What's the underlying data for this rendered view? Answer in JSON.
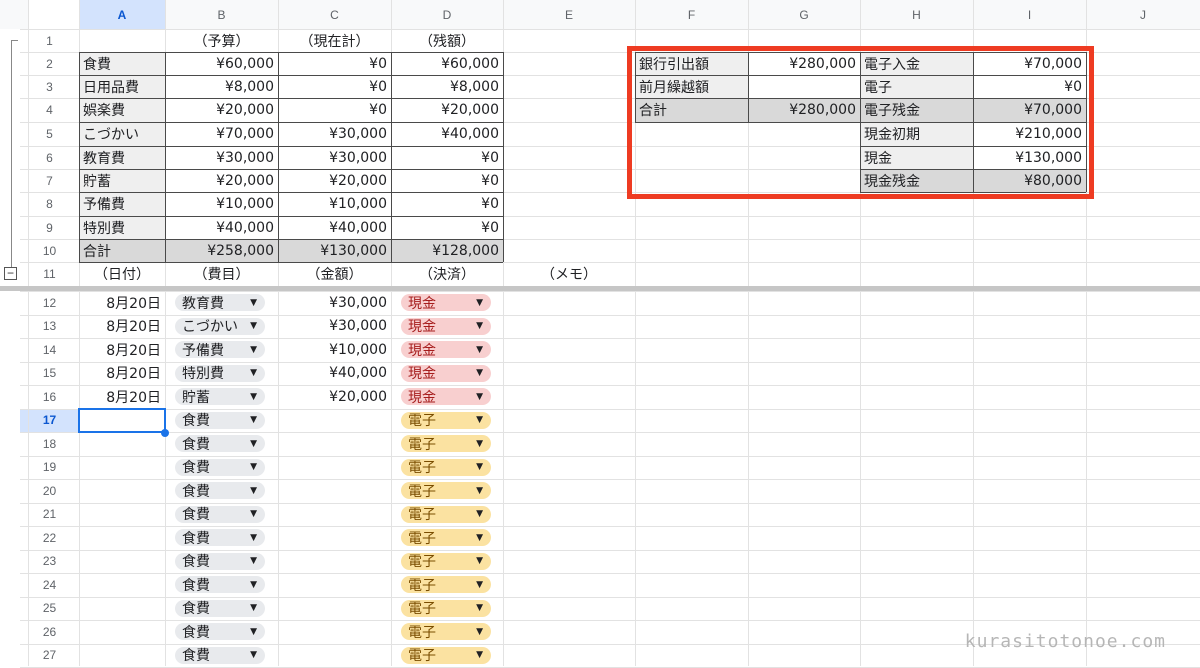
{
  "colors": {
    "header_bg": "#f8f9fa",
    "selected_header_bg": "#d3e3fd",
    "label_bg": "#efefef",
    "total_bg": "#d9d9d9",
    "highlight_border": "#ee3b22",
    "cash_chip": "#f8cfcf",
    "electronic_chip": "#fbe2a1",
    "category_chip": "#e8eaed",
    "active_cell_border": "#1a73e8"
  },
  "columns": [
    "A",
    "B",
    "C",
    "D",
    "E",
    "F",
    "G",
    "H",
    "I",
    "J"
  ],
  "selected_column": "A",
  "row_numbers": [
    "1",
    "2",
    "3",
    "4",
    "5",
    "6",
    "7",
    "8",
    "9",
    "10",
    "11",
    "12",
    "13",
    "14",
    "15",
    "16",
    "17",
    "18",
    "19",
    "20",
    "21",
    "22",
    "23",
    "24",
    "25",
    "26",
    "27"
  ],
  "selected_row": "17",
  "group_toggle": "−",
  "budget": {
    "headers": [
      "（予算）",
      "（現在計）",
      "（残額）"
    ],
    "rows": [
      {
        "name": "食費",
        "budget": "¥60,000",
        "current": "¥0",
        "remaining": "¥60,000"
      },
      {
        "name": "日用品費",
        "budget": "¥8,000",
        "current": "¥0",
        "remaining": "¥8,000"
      },
      {
        "name": "娯楽費",
        "budget": "¥20,000",
        "current": "¥0",
        "remaining": "¥20,000"
      },
      {
        "name": "こづかい",
        "budget": "¥70,000",
        "current": "¥30,000",
        "remaining": "¥40,000"
      },
      {
        "name": "教育費",
        "budget": "¥30,000",
        "current": "¥30,000",
        "remaining": "¥0"
      },
      {
        "name": "貯蓄",
        "budget": "¥20,000",
        "current": "¥20,000",
        "remaining": "¥0"
      },
      {
        "name": "予備費",
        "budget": "¥10,000",
        "current": "¥10,000",
        "remaining": "¥0"
      },
      {
        "name": "特別費",
        "budget": "¥40,000",
        "current": "¥40,000",
        "remaining": "¥0"
      }
    ],
    "total": {
      "name": "合計",
      "budget": "¥258,000",
      "current": "¥130,000",
      "remaining": "¥128,000"
    }
  },
  "summary": {
    "left": [
      {
        "label": "銀行引出額",
        "value": "¥280,000"
      },
      {
        "label": "前月繰越額",
        "value": ""
      },
      {
        "label": "合計",
        "value": "¥280,000"
      }
    ],
    "right": [
      {
        "label": "電子入金",
        "value": "¥70,000"
      },
      {
        "label": "電子",
        "value": "¥0"
      },
      {
        "label": "電子残金",
        "value": "¥70,000"
      },
      {
        "label": "現金初期",
        "value": "¥210,000"
      },
      {
        "label": "現金",
        "value": "¥130,000"
      },
      {
        "label": "現金残金",
        "value": "¥80,000"
      }
    ]
  },
  "log_headers": [
    "（日付）",
    "（費目）",
    "（金額）",
    "（決済）",
    "（メモ）"
  ],
  "log": [
    {
      "date": "8月20日",
      "category": "教育費",
      "amount": "¥30,000",
      "payment": "現金"
    },
    {
      "date": "8月20日",
      "category": "こづかい",
      "amount": "¥30,000",
      "payment": "現金"
    },
    {
      "date": "8月20日",
      "category": "予備費",
      "amount": "¥10,000",
      "payment": "現金"
    },
    {
      "date": "8月20日",
      "category": "特別費",
      "amount": "¥40,000",
      "payment": "現金"
    },
    {
      "date": "8月20日",
      "category": "貯蓄",
      "amount": "¥20,000",
      "payment": "現金"
    },
    {
      "date": "",
      "category": "食費",
      "amount": "",
      "payment": "電子"
    },
    {
      "date": "",
      "category": "食費",
      "amount": "",
      "payment": "電子"
    },
    {
      "date": "",
      "category": "食費",
      "amount": "",
      "payment": "電子"
    },
    {
      "date": "",
      "category": "食費",
      "amount": "",
      "payment": "電子"
    },
    {
      "date": "",
      "category": "食費",
      "amount": "",
      "payment": "電子"
    },
    {
      "date": "",
      "category": "食費",
      "amount": "",
      "payment": "電子"
    },
    {
      "date": "",
      "category": "食費",
      "amount": "",
      "payment": "電子"
    },
    {
      "date": "",
      "category": "食費",
      "amount": "",
      "payment": "電子"
    },
    {
      "date": "",
      "category": "食費",
      "amount": "",
      "payment": "電子"
    },
    {
      "date": "",
      "category": "食費",
      "amount": "",
      "payment": "電子"
    },
    {
      "date": "",
      "category": "食費",
      "amount": "",
      "payment": "電子"
    }
  ],
  "watermark": "kurasitotonoe.com"
}
